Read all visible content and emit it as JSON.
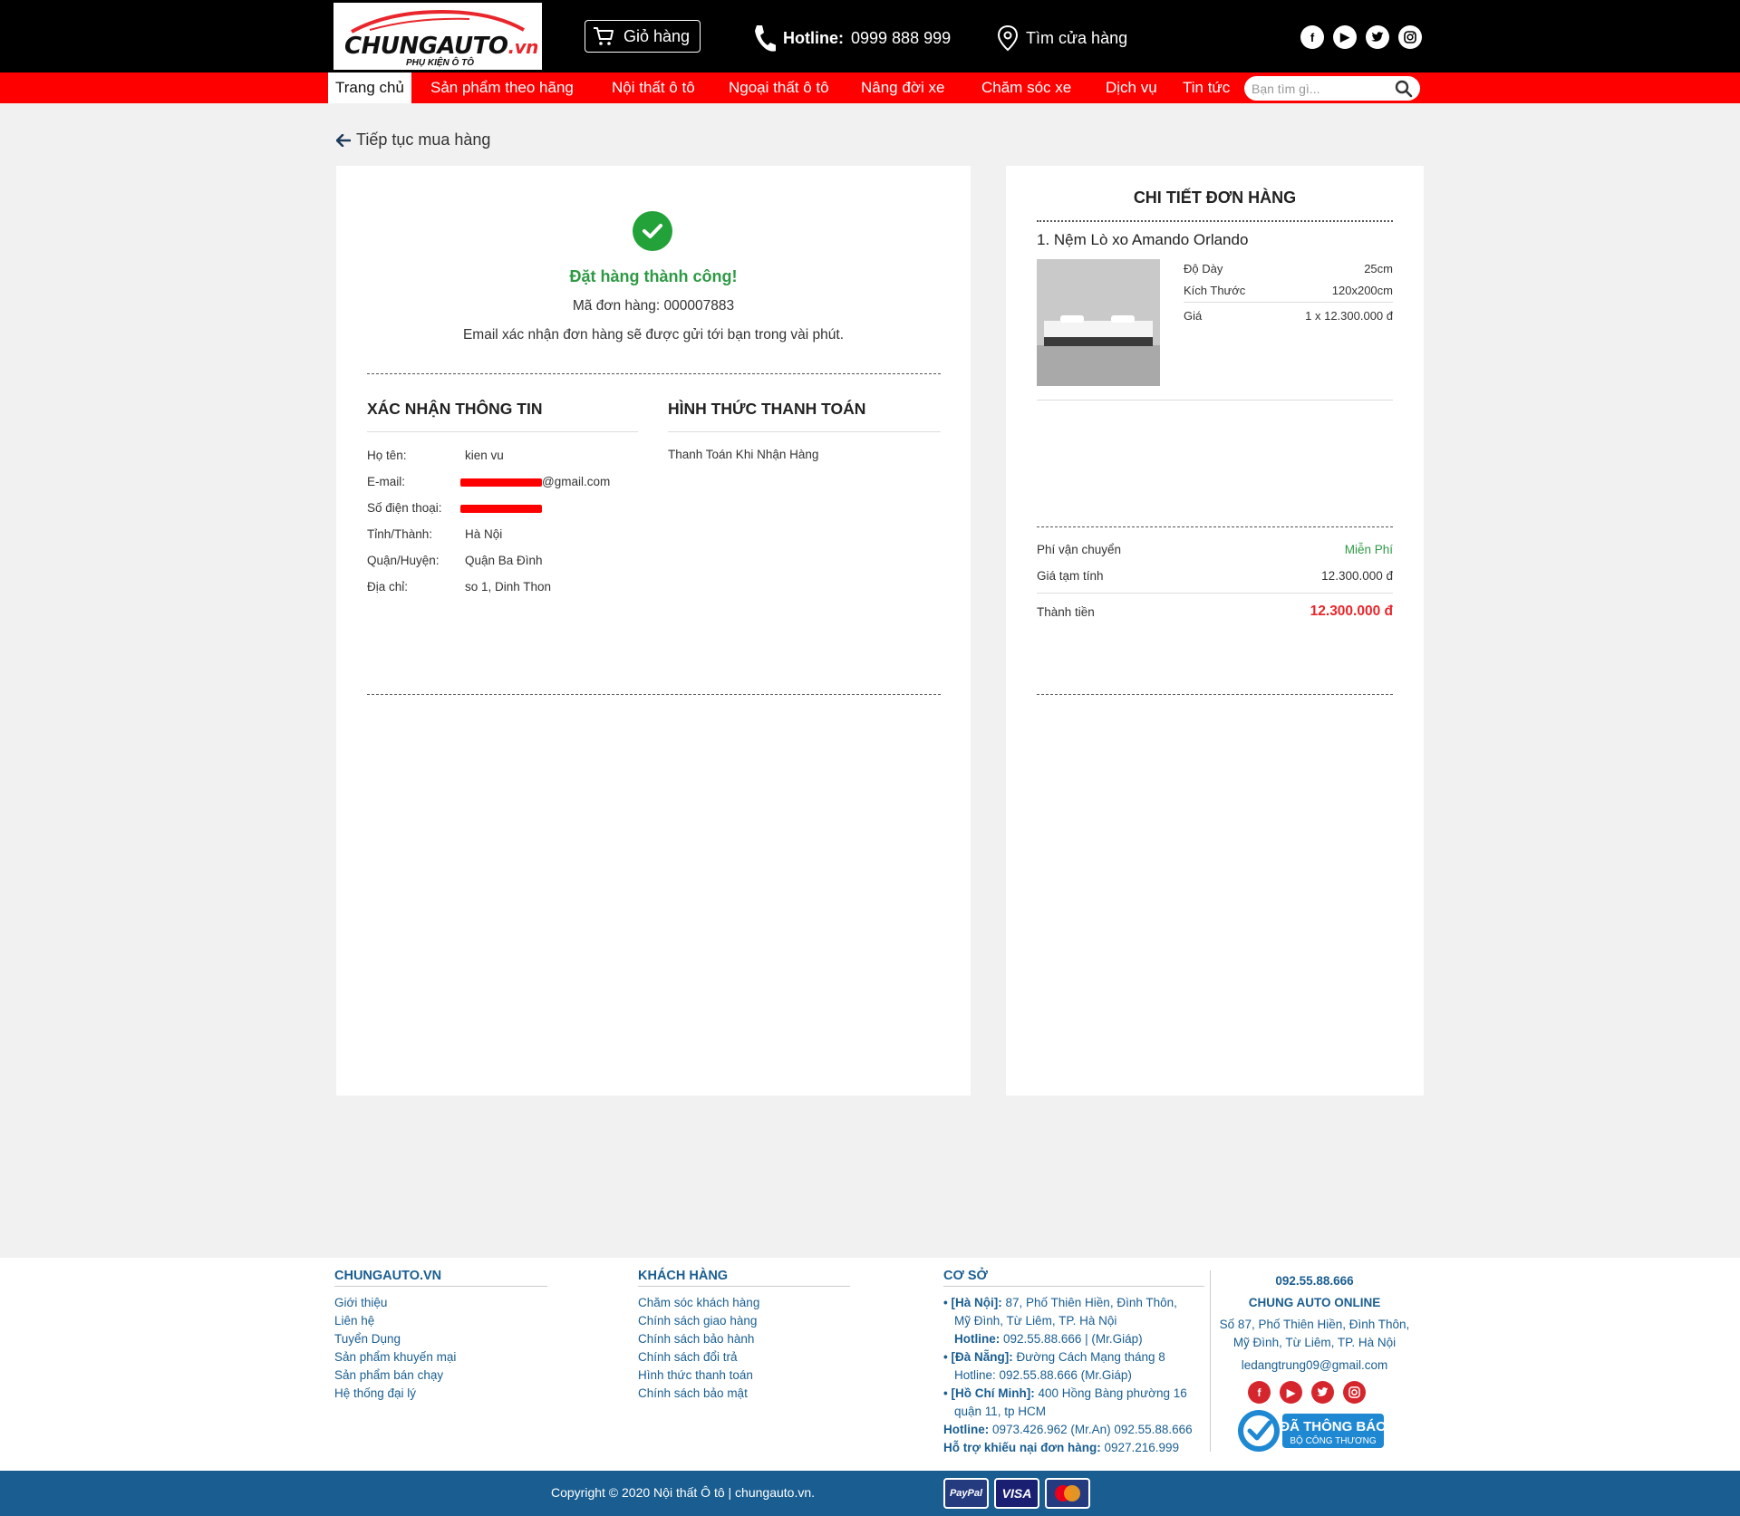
{
  "header": {
    "logo_text": "CHUNGAUTO",
    "logo_suffix": ".vn",
    "logo_tagline": "PHỤ KIỆN Ô TÔ",
    "cart_label": "Giỏ hàng",
    "hotline_label": "Hotline:",
    "hotline_number": "0999 888 999",
    "store_label": "Tìm cửa hàng",
    "socials": [
      "facebook-icon",
      "youtube-icon",
      "twitter-icon",
      "instagram-icon"
    ]
  },
  "nav": {
    "items": [
      "Trang chủ",
      "Sản phẩm theo hãng",
      "Nội thất ô tô",
      "Ngoại thất ô tô",
      "Nâng đời xe",
      "Chăm sóc xe",
      "Dịch vụ",
      "Tin tức"
    ],
    "search_placeholder": "Bạn tìm gì..."
  },
  "main": {
    "back_link": "Tiếp tục mua hàng",
    "success_title": "Đặt hàng thành công!",
    "order_code": "Mã đơn hàng: 000007883",
    "email_note": "Email xác nhận đơn hàng sẽ được gửi tới bạn trong vài phút.",
    "confirm_title": "XÁC NHẬN THÔNG TIN",
    "payment_title": "HÌNH THỨC THANH TOÁN",
    "payment_method": "Thanh Toán Khi Nhận Hàng",
    "info": [
      {
        "label": "Họ tên:",
        "value": "kien vu"
      },
      {
        "label": "E-mail:",
        "value": "@gmail.com"
      },
      {
        "label": "Số điện thoại:",
        "value": ""
      },
      {
        "label": "Tỉnh/Thành:",
        "value": "Hà Nội"
      },
      {
        "label": "Quận/Huyện:",
        "value": "Quận Ba Đình"
      },
      {
        "label": "Địa chỉ:",
        "value": "so 1, Dinh Thon"
      }
    ]
  },
  "order": {
    "title": "CHI TIẾT ĐƠN HÀNG",
    "product_name": "1. Nệm Lò xo Amando Orlando",
    "attrs": [
      {
        "label": "Độ Dày",
        "value": "25cm"
      },
      {
        "label": "Kích Thước",
        "value": "120x200cm"
      },
      {
        "label": "Giá",
        "value": "1 x 12.300.000 đ"
      }
    ],
    "shipping_label": "Phí vận chuyển",
    "shipping_value": "Miễn Phí",
    "subtotal_label": "Giá tạm tính",
    "subtotal_value": "12.300.000 đ",
    "total_label": "Thành tiền",
    "total_value": "12.300.000 đ"
  },
  "footer": {
    "col1_title": "CHUNGAUTO.VN",
    "col1_links": [
      "Giới thiệu",
      "Liên hệ",
      "Tuyển Dụng",
      "Sản phẩm khuyến mại",
      "Sản phẩm bán chạy",
      "Hệ thống đại lý"
    ],
    "col2_title": "KHÁCH HÀNG",
    "col2_links": [
      "Chăm sóc khách hàng",
      "Chính sách giao hàng",
      "Chính sách bảo hành",
      "Chính sách đổi trả",
      "Hình thức thanh toán",
      "Chính sách bảo mật"
    ],
    "col3_title": "CƠ SỞ",
    "hn_label": "• [Hà Nội]:",
    "hn_addr1": "87, Phố Thiên Hiền, Đình Thôn,",
    "hn_addr2": "Mỹ Đình, Từ Liêm, TP. Hà Nội",
    "hn_hotline_label": "Hotline:",
    "hn_hotline": "092.55.88.666 | (Mr.Giáp)",
    "dn_label": "• [Đà Nẵng]:",
    "dn_addr": "Đường Cách Mạng tháng 8",
    "dn_hotline": "Hotline: 092.55.88.666 (Mr.Giáp)",
    "hcm_label": "• [Hồ Chí Minh]:",
    "hcm_addr1": "400 Hồng Bàng phường 16",
    "hcm_addr2": "quận 11, tp HCM",
    "hotline_label": "Hotline:",
    "hotline_value": "0973.426.962 (Mr.An) 092.55.88.666",
    "complaint_label": "Hỗ trợ khiếu nại đơn hàng:",
    "complaint_value": "0927.216.999",
    "online_phone": "092.55.88.666",
    "online_title": "CHUNG AUTO ONLINE",
    "online_addr1": "Số 87, Phố Thiên Hiền, Đình Thôn,",
    "online_addr2": "Mỹ Đình, Từ Liêm, TP. Hà Nội",
    "online_email": "ledangtrung09@gmail.com",
    "badge_title": "ĐÃ THÔNG BÁO",
    "badge_sub": "BỘ CÔNG THƯƠNG",
    "copyright": "Copyright © 2020 Nội thất Ô tô | chungauto.vn.",
    "pay_paypal": "PayPal",
    "pay_visa": "VISA"
  },
  "colors": {
    "nav_red": "#ff0000",
    "success_green": "#24a23a",
    "total_red": "#e8262b",
    "footer_blue": "#1a5e91"
  }
}
